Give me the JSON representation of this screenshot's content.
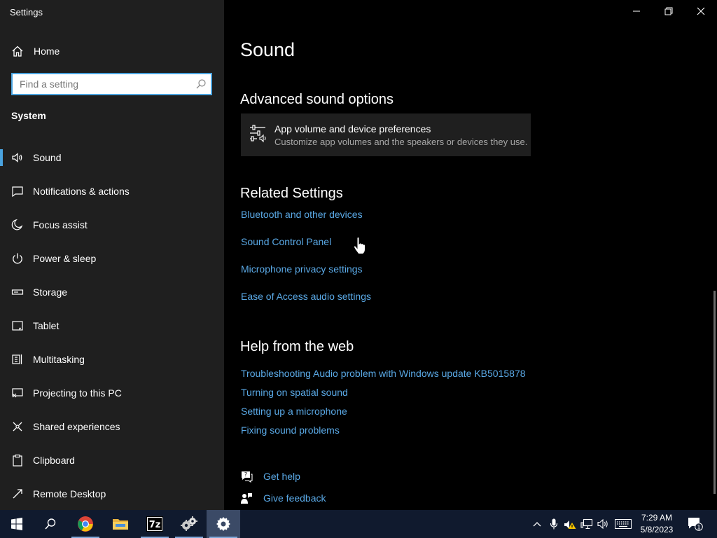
{
  "window": {
    "title": "Settings"
  },
  "sidebar": {
    "home_label": "Home",
    "search_placeholder": "Find a setting",
    "section_label": "System",
    "items": [
      {
        "label": "Sound",
        "icon": "speaker-icon",
        "active": true
      },
      {
        "label": "Notifications & actions",
        "icon": "notification-icon"
      },
      {
        "label": "Focus assist",
        "icon": "moon-icon"
      },
      {
        "label": "Power & sleep",
        "icon": "power-icon"
      },
      {
        "label": "Storage",
        "icon": "storage-icon"
      },
      {
        "label": "Tablet",
        "icon": "tablet-icon"
      },
      {
        "label": "Multitasking",
        "icon": "multitasking-icon"
      },
      {
        "label": "Projecting to this PC",
        "icon": "projecting-icon"
      },
      {
        "label": "Shared experiences",
        "icon": "shared-icon"
      },
      {
        "label": "Clipboard",
        "icon": "clipboard-icon"
      },
      {
        "label": "Remote Desktop",
        "icon": "remote-desktop-icon"
      }
    ]
  },
  "main": {
    "title": "Sound",
    "advanced": {
      "heading": "Advanced sound options",
      "card_title": "App volume and device preferences",
      "card_subtitle": "Customize app volumes and the speakers or devices they use."
    },
    "related": {
      "heading": "Related Settings",
      "links": [
        "Bluetooth and other devices",
        "Sound Control Panel",
        "Microphone privacy settings",
        "Ease of Access audio settings"
      ]
    },
    "web_help": {
      "heading": "Help from the web",
      "links": [
        "Troubleshooting Audio problem with Windows update KB5015878",
        "Turning on spatial sound",
        "Setting up a microphone",
        "Fixing sound problems"
      ]
    },
    "get_help": "Get help",
    "give_feedback": "Give feedback"
  },
  "taskbar": {
    "clock_time": "7:29 AM",
    "clock_date": "5/8/2023",
    "notification_count": "1",
    "apps": [
      "start-icon",
      "search-icon",
      "chrome-icon",
      "file-explorer-icon",
      "7zip-icon",
      "settings-gears-icon",
      "settings-icon"
    ]
  },
  "colors": {
    "accent": "#4aa3df",
    "link": "#5aa9e6",
    "sidebar_bg": "#1f1f1f",
    "main_bg": "#000000",
    "taskbar_bg": "#101a2e"
  }
}
